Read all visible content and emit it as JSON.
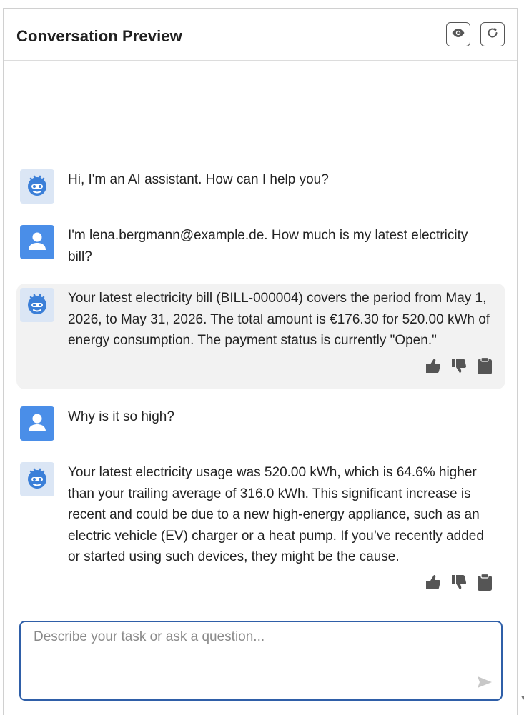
{
  "header": {
    "title": "Conversation Preview",
    "buttons": [
      {
        "name": "preview",
        "icon": "eye-icon"
      },
      {
        "name": "restart",
        "icon": "refresh-icon"
      }
    ]
  },
  "messages": [
    {
      "role": "assistant",
      "avatar": "robot-icon",
      "text": "Hi, I'm an AI assistant. How can I help you?"
    },
    {
      "role": "user",
      "avatar": "user-icon",
      "text": "I'm lena.bergmann@example.de. How much is my latest electricity bill?"
    },
    {
      "role": "assistant",
      "avatar": "robot-icon",
      "text": "Your latest electricity bill (BILL-000004) covers the period from May 1, 2026, to May 31, 2026. The total amount is €176.30 for 520.00 kWh of energy consumption. The payment status is currently \"Open.\"",
      "actions": [
        "thumbs-up-icon",
        "thumbs-down-icon",
        "clipboard-icon"
      ]
    },
    {
      "role": "user",
      "avatar": "user-icon",
      "text": "Why is it so high?"
    },
    {
      "role": "assistant",
      "avatar": "robot-icon",
      "text": "Your latest electricity usage was 520.00 kWh, which is 64.6% higher than your trailing average of 316.0 kWh. This significant increase is recent and could be due to a new high-energy appliance, such as an electric vehicle (EV) charger or a heat pump. If you’ve recently added or started using such devices, they might be the cause.",
      "actions": [
        "thumbs-up-icon",
        "thumbs-down-icon",
        "clipboard-icon"
      ]
    }
  ],
  "composer": {
    "placeholder": "Describe your task or ask a question...",
    "value": "",
    "send_icon": "send-icon"
  },
  "colors": {
    "accent": "#2f5fa8",
    "user_avatar": "#4a8ee8",
    "bot_avatar_bg": "#dbe6f5",
    "highlight_bg": "#f2f2f2"
  }
}
